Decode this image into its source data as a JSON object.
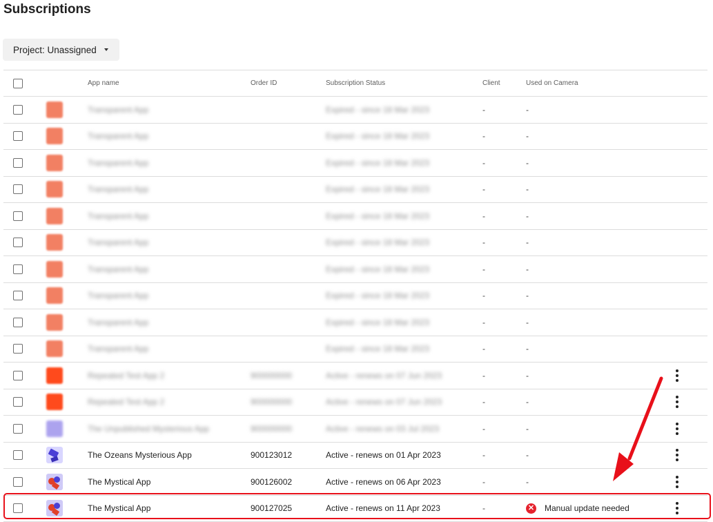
{
  "page": {
    "title": "Subscriptions"
  },
  "filter": {
    "project_label": "Project: Unassigned"
  },
  "table": {
    "headers": {
      "app_name": "App name",
      "order_id": "Order ID",
      "status": "Subscription Status",
      "client": "Client",
      "camera": "Used on Camera"
    },
    "rows": [
      {
        "icon": "orange",
        "name": "Transparent App",
        "order_id": "",
        "status": "Expired - since 18 Mar 2023",
        "client": "-",
        "camera": "-",
        "blurred": true,
        "menu": false,
        "error": false
      },
      {
        "icon": "orange",
        "name": "Transparent App",
        "order_id": "",
        "status": "Expired - since 18 Mar 2023",
        "client": "-",
        "camera": "-",
        "blurred": true,
        "menu": false,
        "error": false
      },
      {
        "icon": "orange",
        "name": "Transparent App",
        "order_id": "",
        "status": "Expired - since 18 Mar 2023",
        "client": "-",
        "camera": "-",
        "blurred": true,
        "menu": false,
        "error": false
      },
      {
        "icon": "orange",
        "name": "Transparent App",
        "order_id": "",
        "status": "Expired - since 18 Mar 2023",
        "client": "-",
        "camera": "-",
        "blurred": true,
        "menu": false,
        "error": false
      },
      {
        "icon": "orange",
        "name": "Transparent App",
        "order_id": "",
        "status": "Expired - since 18 Mar 2023",
        "client": "-",
        "camera": "-",
        "blurred": true,
        "menu": false,
        "error": false
      },
      {
        "icon": "orange",
        "name": "Transparent App",
        "order_id": "",
        "status": "Expired - since 18 Mar 2023",
        "client": "-",
        "camera": "-",
        "blurred": true,
        "menu": false,
        "error": false
      },
      {
        "icon": "orange",
        "name": "Transparent App",
        "order_id": "",
        "status": "Expired - since 18 Mar 2023",
        "client": "-",
        "camera": "-",
        "blurred": true,
        "menu": false,
        "error": false
      },
      {
        "icon": "orange",
        "name": "Transparent App",
        "order_id": "",
        "status": "Expired - since 18 Mar 2023",
        "client": "-",
        "camera": "-",
        "blurred": true,
        "menu": false,
        "error": false
      },
      {
        "icon": "orange",
        "name": "Transparent App",
        "order_id": "",
        "status": "Expired - since 18 Mar 2023",
        "client": "-",
        "camera": "-",
        "blurred": true,
        "menu": false,
        "error": false
      },
      {
        "icon": "orange",
        "name": "Transparent App",
        "order_id": "",
        "status": "Expired - since 18 Mar 2023",
        "client": "-",
        "camera": "-",
        "blurred": true,
        "menu": false,
        "error": false
      },
      {
        "icon": "red",
        "name": "Repeated Test App 2",
        "order_id": "900000000",
        "status": "Active - renews on 07 Jun 2023",
        "client": "-",
        "camera": "-",
        "blurred": true,
        "menu": true,
        "error": false
      },
      {
        "icon": "red",
        "name": "Repeated Test App 2",
        "order_id": "900000000",
        "status": "Active - renews on 07 Jun 2023",
        "client": "-",
        "camera": "-",
        "blurred": true,
        "menu": true,
        "error": false
      },
      {
        "icon": "purple",
        "name": "The Unpublished Mysterious App",
        "order_id": "900000000",
        "status": "Active - renews on 03 Jul 2023",
        "client": "-",
        "camera": "-",
        "blurred": true,
        "menu": true,
        "error": false
      },
      {
        "icon": "cam",
        "name": "The Ozeans Mysterious App",
        "order_id": "900123012",
        "status": "Active - renews on 01 Apr 2023",
        "client": "-",
        "camera": "-",
        "blurred": false,
        "menu": true,
        "error": false
      },
      {
        "icon": "myst",
        "name": "The Mystical App",
        "order_id": "900126002",
        "status": "Active - renews on 06 Apr 2023",
        "client": "-",
        "camera": "-",
        "blurred": false,
        "menu": true,
        "error": false
      },
      {
        "icon": "myst",
        "name": "The Mystical App",
        "order_id": "900127025",
        "status": "Active - renews on 11 Apr 2023",
        "client": "-",
        "camera": "Manual update needed",
        "blurred": false,
        "menu": true,
        "error": true
      }
    ]
  },
  "colors": {
    "highlight": "#e8101a",
    "error": "#e5222d"
  }
}
